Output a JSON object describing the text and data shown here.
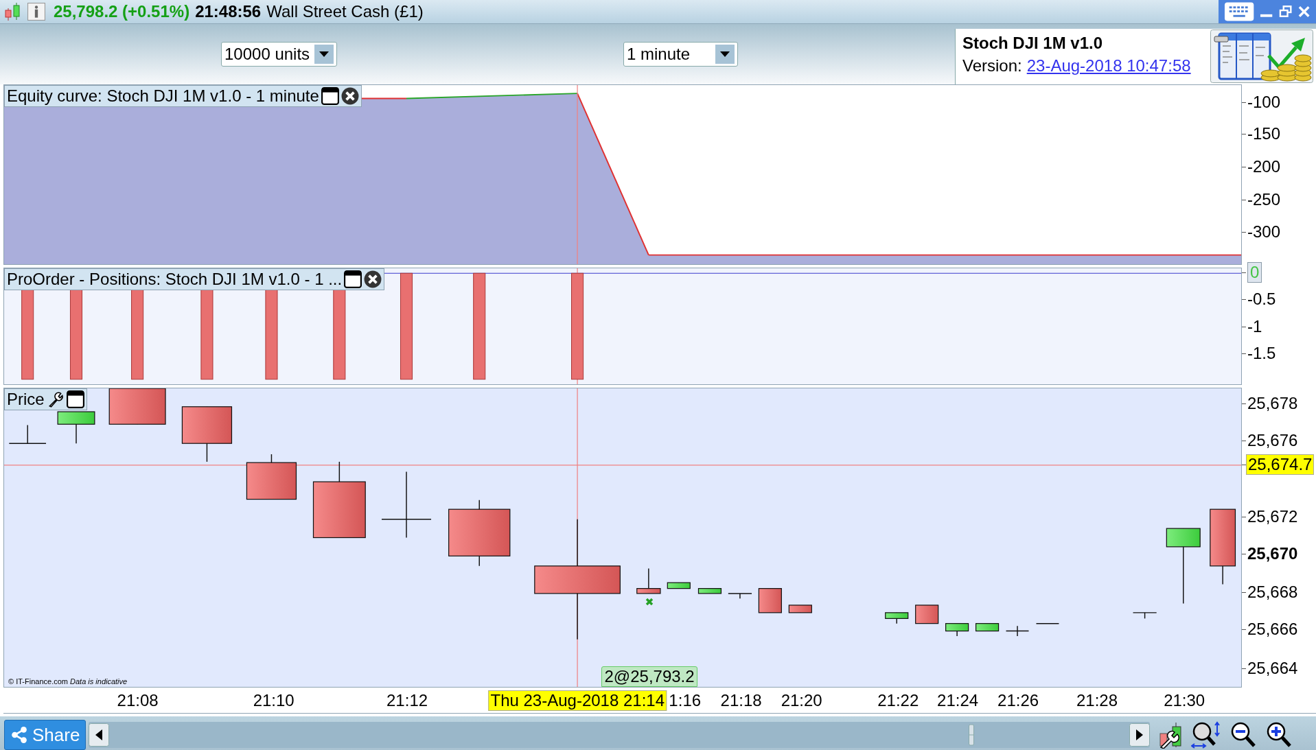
{
  "title_bar": {
    "price": "25,798.2 (+0.51%)",
    "time": "21:48:56",
    "instrument": "Wall Street Cash (£1)"
  },
  "toolbar": {
    "quantity": "10000 units",
    "timeframe": "1 minute"
  },
  "system": {
    "name": "Stoch DJI 1M v1.0",
    "version_label": "Version:",
    "version": "23-Aug-2018 10:47:58"
  },
  "equity_panel": {
    "title": "Equity curve: Stoch DJI 1M v1.0 - 1 minute",
    "axis_labels": [
      "-100",
      "-150",
      "-200",
      "-250",
      "-300"
    ]
  },
  "positions_panel": {
    "title": "ProOrder - Positions: Stoch DJI 1M v1.0 - 1 ...",
    "last_value": "0",
    "axis_labels": [
      "-0.5",
      "-1",
      "-1.5"
    ]
  },
  "price_panel": {
    "title": "Price",
    "axis_labels": [
      {
        "label": "25,678",
        "bold": false
      },
      {
        "label": "25,676",
        "bold": false
      },
      {
        "label": "25,672",
        "bold": false
      },
      {
        "label": "25,670",
        "bold": true
      },
      {
        "label": "25,668",
        "bold": false
      },
      {
        "label": "25,666",
        "bold": false
      },
      {
        "label": "25,664",
        "bold": false
      }
    ],
    "crosshair_price": "25,674.7",
    "trade_label": "2@25,793.2",
    "credit": "© IT-Finance.com *Data is indicative*"
  },
  "time_axis": {
    "labels": [
      "21:08",
      "21:10",
      "21:12",
      "1:16",
      "21:18",
      "21:20",
      "21:22",
      "21:24",
      "21:26",
      "21:28",
      "21:30"
    ],
    "crosshair_time": "Thu 23-Aug-2018 21:14"
  },
  "bottom_bar": {
    "share": "Share"
  }
}
